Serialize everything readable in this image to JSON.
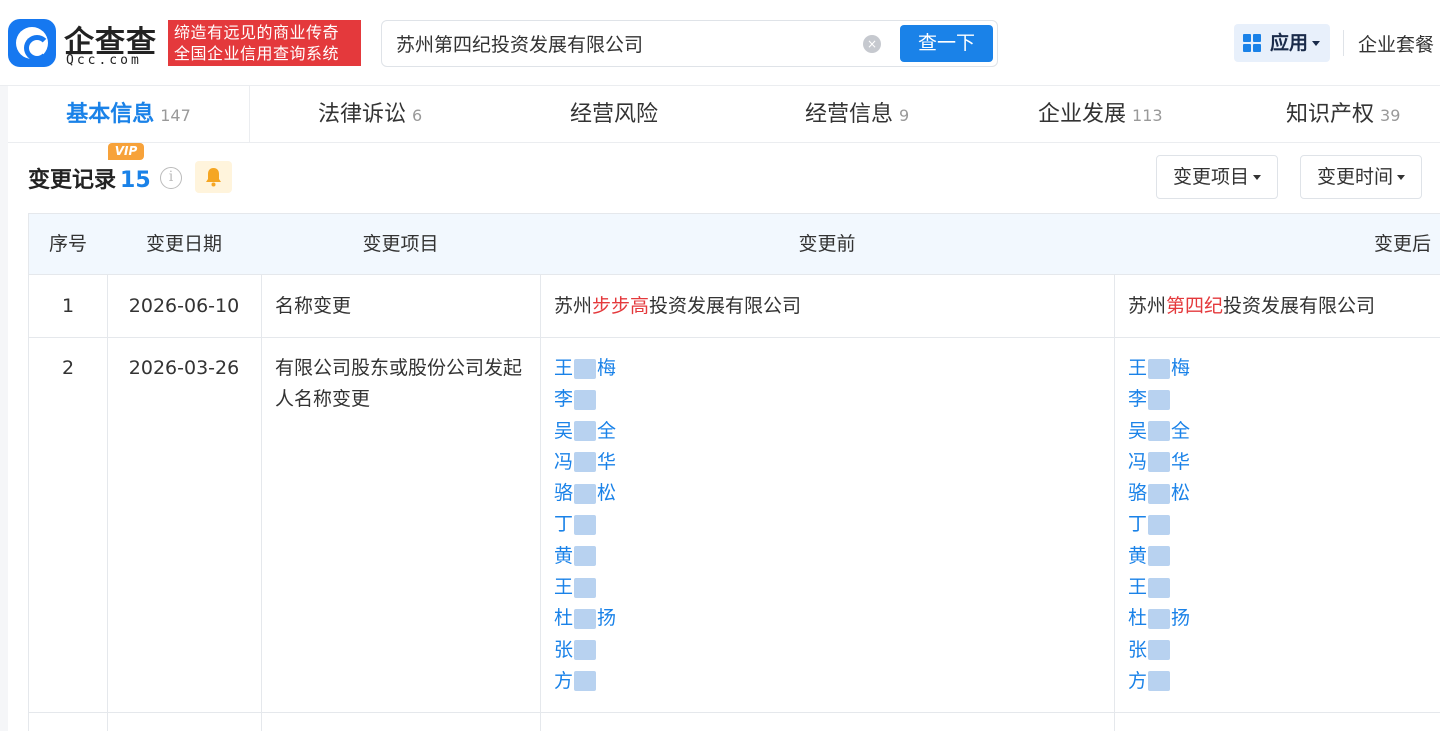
{
  "header": {
    "logo_name": "企查查",
    "logo_domain": "Qcc.com",
    "slogan_line1": "缔造有远见的商业传奇",
    "slogan_line2": "全国企业信用查询系统",
    "search_value": "苏州第四纪投资发展有限公司",
    "clear_glyph": "×",
    "search_button": "查一下",
    "apps_button": "应用",
    "suite_link": "企业套餐"
  },
  "tabs": [
    {
      "label": "基本信息",
      "count": "147"
    },
    {
      "label": "法律诉讼",
      "count": "6"
    },
    {
      "label": "经营风险",
      "count": ""
    },
    {
      "label": "经营信息",
      "count": "9"
    },
    {
      "label": "企业发展",
      "count": "113"
    },
    {
      "label": "知识产权",
      "count": "39"
    }
  ],
  "section": {
    "title": "变更记录",
    "count": "15",
    "vip_badge": "VIP",
    "info_glyph": "i",
    "filter_item": "变更项目",
    "filter_time": "变更时间"
  },
  "table": {
    "headers": [
      "序号",
      "变更日期",
      "变更项目",
      "变更前",
      "变更后"
    ],
    "rows": [
      {
        "index": "1",
        "date": "2026-06-10",
        "item": "名称变更",
        "before": {
          "pre": "苏州",
          "highlight": "步步高",
          "post": "投资发展有限公司"
        },
        "after": {
          "pre": "苏州",
          "highlight": "第四纪",
          "post": "投资发展有限公司"
        }
      },
      {
        "index": "2",
        "date": "2026-03-26",
        "item": "有限公司股东或股份公司发起人名称变更",
        "before_names": [
          {
            "first": "王",
            "last": "梅"
          },
          {
            "first": "李",
            "last": ""
          },
          {
            "first": "吴",
            "last": "全"
          },
          {
            "first": "冯",
            "last": "华"
          },
          {
            "first": "骆",
            "last": "松"
          },
          {
            "first": "丁",
            "last": ""
          },
          {
            "first": "黄",
            "last": ""
          },
          {
            "first": "王",
            "last": ""
          },
          {
            "first": "杜",
            "last": "扬"
          },
          {
            "first": "张",
            "last": ""
          },
          {
            "first": "方",
            "last": ""
          }
        ],
        "after_names": [
          {
            "first": "王",
            "last": "梅"
          },
          {
            "first": "李",
            "last": ""
          },
          {
            "first": "吴",
            "last": "全"
          },
          {
            "first": "冯",
            "last": "华"
          },
          {
            "first": "骆",
            "last": "松"
          },
          {
            "first": "丁",
            "last": ""
          },
          {
            "first": "黄",
            "last": ""
          },
          {
            "first": "王",
            "last": ""
          },
          {
            "first": "杜",
            "last": "扬"
          },
          {
            "first": "张",
            "last": ""
          },
          {
            "first": "方",
            "last": ""
          }
        ]
      }
    ]
  },
  "colors": {
    "brand": "#1a82e8",
    "highlight": "#e4393c",
    "vip": "#f7a23a"
  },
  "icons": [
    "logo-icon",
    "clear-icon",
    "grid-icon",
    "chevron-down-icon",
    "info-icon",
    "bell-icon"
  ]
}
